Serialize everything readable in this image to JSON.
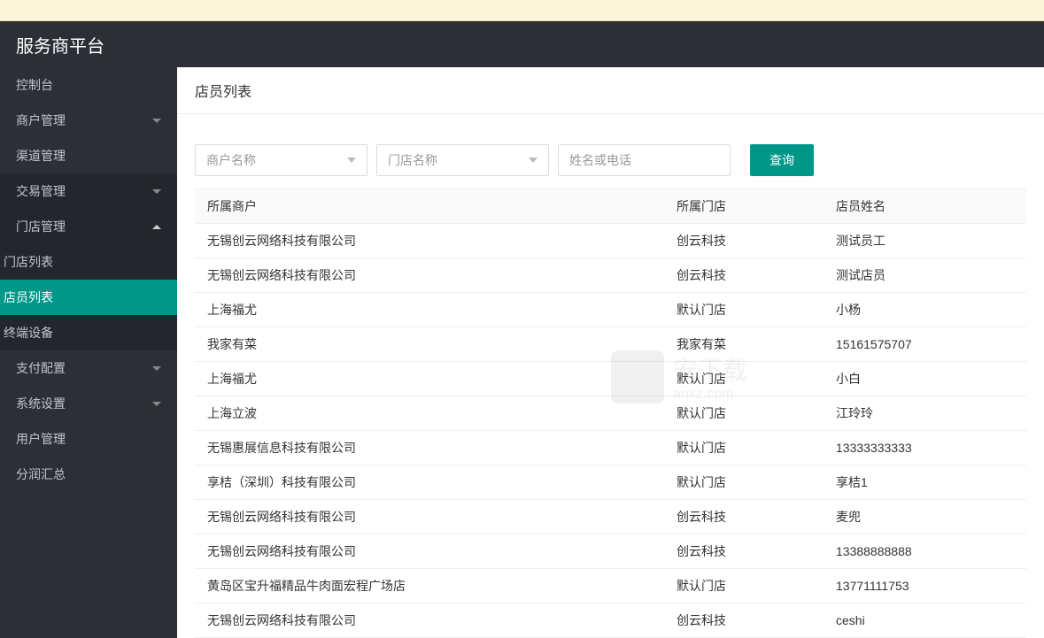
{
  "header": {
    "title": "服务商平台"
  },
  "sidebar": {
    "items": [
      {
        "label": "控制台",
        "expandable": false
      },
      {
        "label": "商户管理",
        "expandable": true,
        "open": false
      },
      {
        "label": "渠道管理",
        "expandable": false
      },
      {
        "label": "交易管理",
        "expandable": true,
        "open": false
      },
      {
        "label": "门店管理",
        "expandable": true,
        "open": true,
        "children": [
          {
            "label": "门店列表"
          },
          {
            "label": "店员列表",
            "active": true
          },
          {
            "label": "终端设备"
          }
        ]
      },
      {
        "label": "支付配置",
        "expandable": true,
        "open": false
      },
      {
        "label": "系统设置",
        "expandable": true,
        "open": false
      },
      {
        "label": "用户管理",
        "expandable": false
      },
      {
        "label": "分润汇总",
        "expandable": false
      }
    ]
  },
  "page": {
    "title": "店员列表"
  },
  "filters": {
    "merchant_placeholder": "商户名称",
    "store_placeholder": "门店名称",
    "keyword_placeholder": "姓名或电话",
    "search_label": "查询"
  },
  "table": {
    "headers": [
      "所属商户",
      "所属门店",
      "店员姓名"
    ],
    "rows": [
      [
        "无锡创云网络科技有限公司",
        "创云科技",
        "测试员工"
      ],
      [
        "无锡创云网络科技有限公司",
        "创云科技",
        "测试店员"
      ],
      [
        "上海福尤",
        "默认门店",
        "小杨"
      ],
      [
        "我家有菜",
        "我家有菜",
        "15161575707"
      ],
      [
        "上海福尤",
        "默认门店",
        "小白"
      ],
      [
        "上海立波",
        "默认门店",
        "江玲玲"
      ],
      [
        "无锡惠展信息科技有限公司",
        "默认门店",
        "13333333333"
      ],
      [
        "享桔（深圳）科技有限公司",
        "默认门店",
        "享桔1"
      ],
      [
        "无锡创云网络科技有限公司",
        "创云科技",
        "麦兜"
      ],
      [
        "无锡创云网络科技有限公司",
        "创云科技",
        "13388888888"
      ],
      [
        "黄岛区宝升福精品牛肉面宏程广场店",
        "默认门店",
        "13771111753"
      ],
      [
        "无锡创云网络科技有限公司",
        "创云科技",
        "ceshi"
      ]
    ]
  },
  "watermark": {
    "text1": "安下载",
    "text2": "anxz.com"
  }
}
